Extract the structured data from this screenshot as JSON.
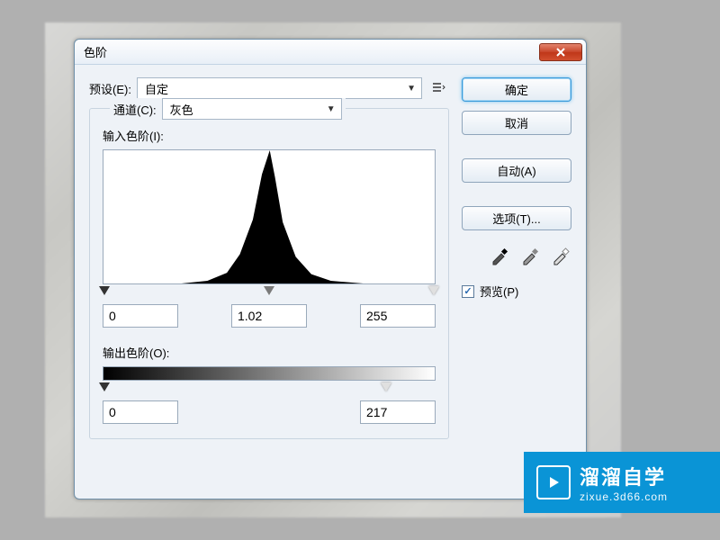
{
  "dialog": {
    "title": "色阶",
    "preset_label": "预设(E):",
    "preset_value": "自定",
    "channel_label": "通道(C):",
    "channel_value": "灰色",
    "input_levels_label": "输入色阶(I):",
    "output_levels_label": "输出色阶(O):",
    "input_black": "0",
    "input_gamma": "1.02",
    "input_white": "255",
    "output_black": "0",
    "output_white": "217"
  },
  "buttons": {
    "ok": "确定",
    "cancel": "取消",
    "auto": "自动(A)",
    "options": "选项(T)..."
  },
  "preview": {
    "label": "预览(P)",
    "checked": "✓"
  },
  "chart_data": {
    "type": "area",
    "title": "",
    "xlabel": "",
    "ylabel": "",
    "xlim": [
      0,
      255
    ],
    "ylim": [
      0,
      100
    ],
    "x": [
      0,
      30,
      60,
      80,
      95,
      105,
      115,
      122,
      128,
      132,
      138,
      148,
      160,
      175,
      200,
      255
    ],
    "values": [
      0,
      0,
      0,
      2,
      8,
      22,
      48,
      82,
      100,
      80,
      46,
      20,
      7,
      2,
      0,
      0
    ]
  },
  "watermark": {
    "title": "溜溜自学",
    "url": "zixue.3d66.com"
  },
  "icons": {
    "close": "X",
    "dropdown": "▼",
    "preset_menu": "≡"
  }
}
